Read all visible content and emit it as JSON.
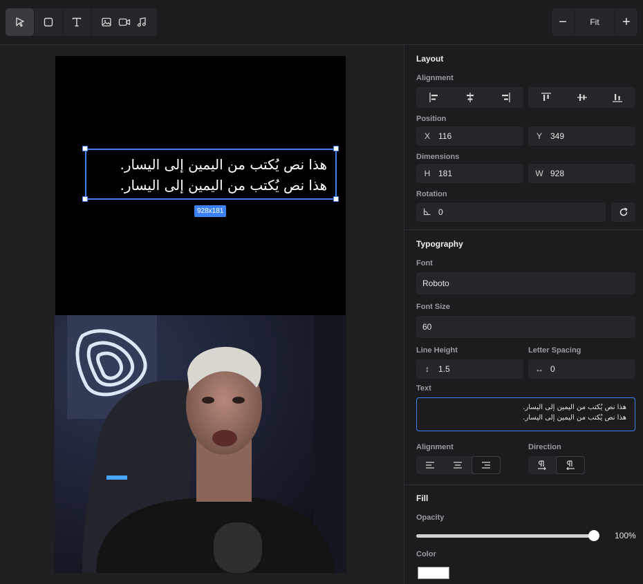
{
  "toolbar": {
    "tools": [
      "select",
      "rectangle",
      "text",
      "image",
      "video",
      "audio"
    ],
    "zoom_out": "−",
    "zoom_label": "Fit",
    "zoom_in": "+"
  },
  "canvas": {
    "text_lines": [
      "هذا نص يُكتب من اليمين إلى اليسار.",
      "هذا نص يُكتب من اليمين إلى اليسار."
    ],
    "size_badge": "928x181"
  },
  "panel": {
    "layout": {
      "title": "Layout",
      "alignment_label": "Alignment",
      "position_label": "Position",
      "x_prefix": "X",
      "x_value": "116",
      "y_prefix": "Y",
      "y_value": "349",
      "dimensions_label": "Dimensions",
      "h_prefix": "H",
      "h_value": "181",
      "w_prefix": "W",
      "w_value": "928",
      "rotation_label": "Rotation",
      "rotation_value": "0"
    },
    "typography": {
      "title": "Typography",
      "font_label": "Font",
      "font_value": "Roboto",
      "font_size_label": "Font Size",
      "font_size_value": "60",
      "line_height_label": "Line Height",
      "line_height_value": "1.5",
      "letter_spacing_label": "Letter Spacing",
      "letter_spacing_value": "0",
      "text_label": "Text",
      "text_lines": [
        "هذا نص يُكتب من اليمين إلى اليسار.",
        "هذا نص يُكتب من اليمين إلى اليسار."
      ],
      "alignment_label": "Alignment",
      "text_alignment_selected": "right",
      "direction_label": "Direction",
      "direction_selected": "rtl"
    },
    "fill": {
      "title": "Fill",
      "opacity_label": "Opacity",
      "opacity_value": "100%",
      "opacity_level": 1.0,
      "color_label": "Color",
      "color_value": "#ffffff"
    }
  },
  "colors": {
    "accent": "#3b82f6",
    "panel_bg": "#1c1c1f",
    "field_bg": "#26262a"
  }
}
